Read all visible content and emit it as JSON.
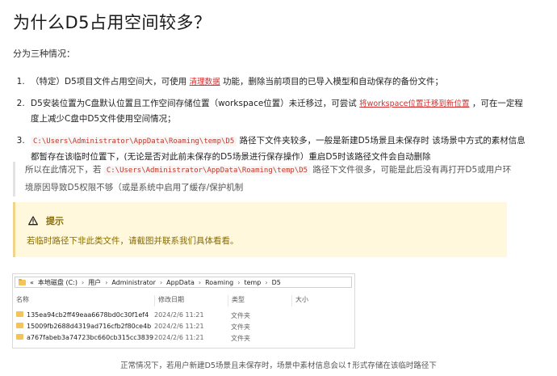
{
  "page_title": "为什么D5占用空间较多？",
  "intro": "分为三种情况：",
  "items": [
    {
      "text_a": "（特定）D5项目文件占用空间大，可使用 ",
      "link": "清理数据",
      "text_b": " 功能，删除当前项目的已导入模型和自动保存的备份文件；"
    },
    {
      "text_a": "D5安装位置为C盘默认位置且工作空间存储位置（workspace位置）未迁移过，可尝试 ",
      "link": "将workspace位置迁移到新位置",
      "text_b": " ，可在一定程度上减少C盘中D5文件使用空间情况；"
    },
    {
      "code": "C:\\Users\\Administrator\\AppData\\Roaming\\temp\\D5",
      "text_b": " 路径下文件夹较多，一般是新建D5场景且未保存时 该场景中方式的素材信息都暂存在该临时位置下，(无论是否对此前未保存的D5场景进行保存操作）重启D5时该路径文件会自动删除"
    }
  ],
  "quote": {
    "text_a": "所以在此情况下，若 ",
    "code": "C:\\Users\\Administrator\\AppData\\Roaming\\temp\\D5",
    "text_b": " 路径下文件很多，可能是此后没有再打开D5或用户环境原因导致D5权限不够（或是系统中启用了缓存/保护机制"
  },
  "tip": {
    "title": "提示",
    "body": "若临时路径下非此类文件，请截图并联系我们具体看看。",
    "icon": "warning-icon"
  },
  "explorer": {
    "back": "«",
    "path": [
      "本地磁盘 (C:)",
      "用户",
      "Administrator",
      "AppData",
      "Roaming",
      "temp",
      "D5"
    ],
    "columns": [
      "名称",
      "修改日期",
      "类型",
      "大小"
    ],
    "rows": [
      {
        "name": "135ea94cb2ff49eaa6678bd0c30f1ef4",
        "date": "2024/2/6 11:21",
        "type": "文件夹",
        "size": ""
      },
      {
        "name": "15009fb2688d4319ad716cfb2f80ce4b",
        "date": "2024/2/6 11:21",
        "type": "文件夹",
        "size": ""
      },
      {
        "name": "a767fabeb3a74723bc660cb315cc3839",
        "date": "2024/2/6 11:21",
        "type": "文件夹",
        "size": ""
      }
    ]
  },
  "caption": "正常情况下，若用户新建D5场景且未保存时，场景中素材信息会以↑形式存储在该临时路径下",
  "colors": {
    "link": "#d03030",
    "tip_bg": "#fff8dc",
    "tip_text": "#8a6d00",
    "code": "#c0392b"
  }
}
